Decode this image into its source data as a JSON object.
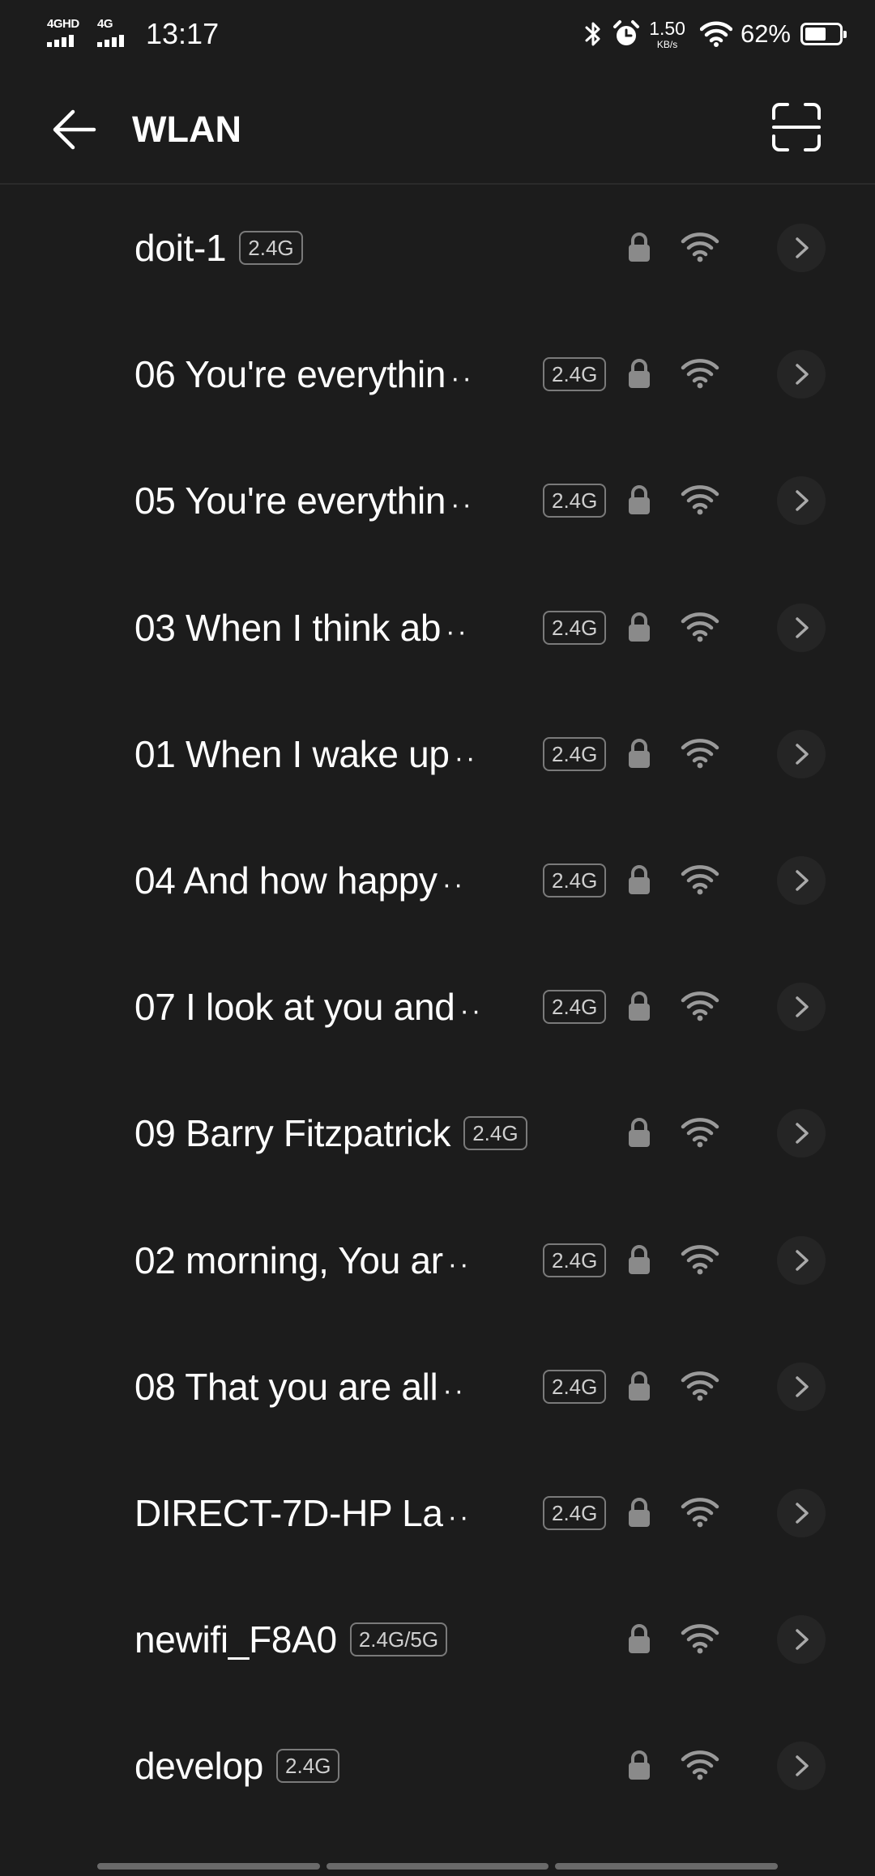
{
  "status_bar": {
    "network1": "4GHD",
    "network2": "4G",
    "time": "13:17",
    "speed_value": "1.50",
    "speed_unit": "KB/s",
    "battery_text": "62%",
    "battery_level": 0.62,
    "icons": [
      "bluetooth-icon",
      "alarm-icon",
      "wifi-status-icon",
      "battery-icon"
    ]
  },
  "header": {
    "title": "WLAN",
    "back_icon": "arrow-left-icon",
    "scan_icon": "scan-icon"
  },
  "networks": [
    {
      "ssid": "doit-1",
      "band": "2.4G",
      "truncated": false
    },
    {
      "ssid": "06 You're everythin",
      "band": "2.4G",
      "truncated": true
    },
    {
      "ssid": "05 You're everythin",
      "band": "2.4G",
      "truncated": true
    },
    {
      "ssid": "03 When I think ab",
      "band": "2.4G",
      "truncated": true
    },
    {
      "ssid": "01 When I wake up",
      "band": "2.4G",
      "truncated": true
    },
    {
      "ssid": "04 And how happy",
      "band": "2.4G",
      "truncated": true
    },
    {
      "ssid": "07 I look at you and",
      "band": "2.4G",
      "truncated": true
    },
    {
      "ssid": "09 Barry Fitzpatrick",
      "band": "2.4G",
      "truncated": false
    },
    {
      "ssid": "02 morning, You ar",
      "band": "2.4G",
      "truncated": true
    },
    {
      "ssid": "08 That you are all",
      "band": "2.4G",
      "truncated": true
    },
    {
      "ssid": "DIRECT-7D-HP La",
      "band": "2.4G",
      "truncated": true
    },
    {
      "ssid": "newifi_F8A0",
      "band": "2.4G/5G",
      "truncated": false
    },
    {
      "ssid": "develop",
      "band": "2.4G",
      "truncated": false
    }
  ],
  "colors": {
    "background": "#1c1c1c",
    "text": "#ffffff",
    "icon_gray": "#8a8a8a",
    "band_border": "#7a7a7a"
  }
}
